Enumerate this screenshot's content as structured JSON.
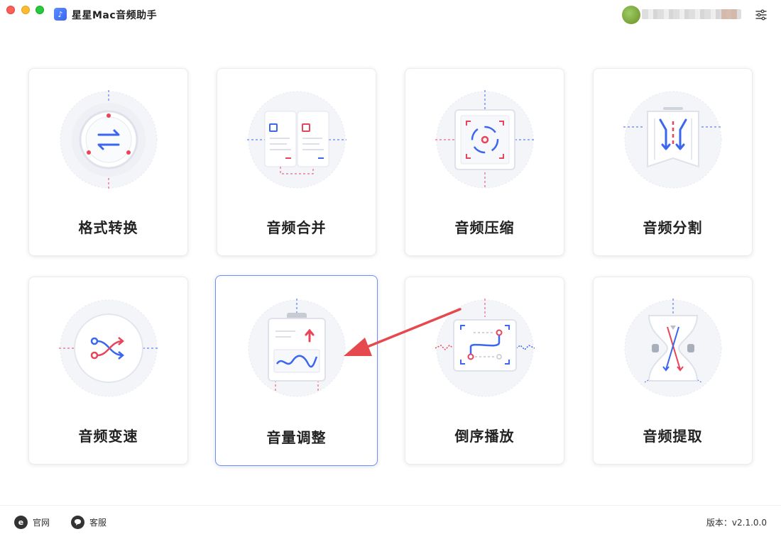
{
  "window": {
    "title": "星星Mac音频助手"
  },
  "header": {
    "settings_icon": "sliders-icon"
  },
  "tools": [
    {
      "label": "格式转换",
      "icon": "format-convert-icon"
    },
    {
      "label": "音频合并",
      "icon": "audio-merge-icon"
    },
    {
      "label": "音频压缩",
      "icon": "audio-compress-icon"
    },
    {
      "label": "音频分割",
      "icon": "audio-split-icon"
    },
    {
      "label": "音频变速",
      "icon": "audio-speed-icon"
    },
    {
      "label": "音量调整",
      "icon": "volume-adjust-icon",
      "selected": true
    },
    {
      "label": "倒序播放",
      "icon": "reverse-play-icon"
    },
    {
      "label": "音频提取",
      "icon": "audio-extract-icon"
    }
  ],
  "footer": {
    "website_label": "官网",
    "support_label": "客服",
    "version_text": "版本：v2.1.0.0"
  },
  "colors": {
    "accent": "#3a66f0",
    "highlight": "#e8445a",
    "selected_border": "#6f8ff0",
    "annotation_arrow": "#e5484d"
  }
}
